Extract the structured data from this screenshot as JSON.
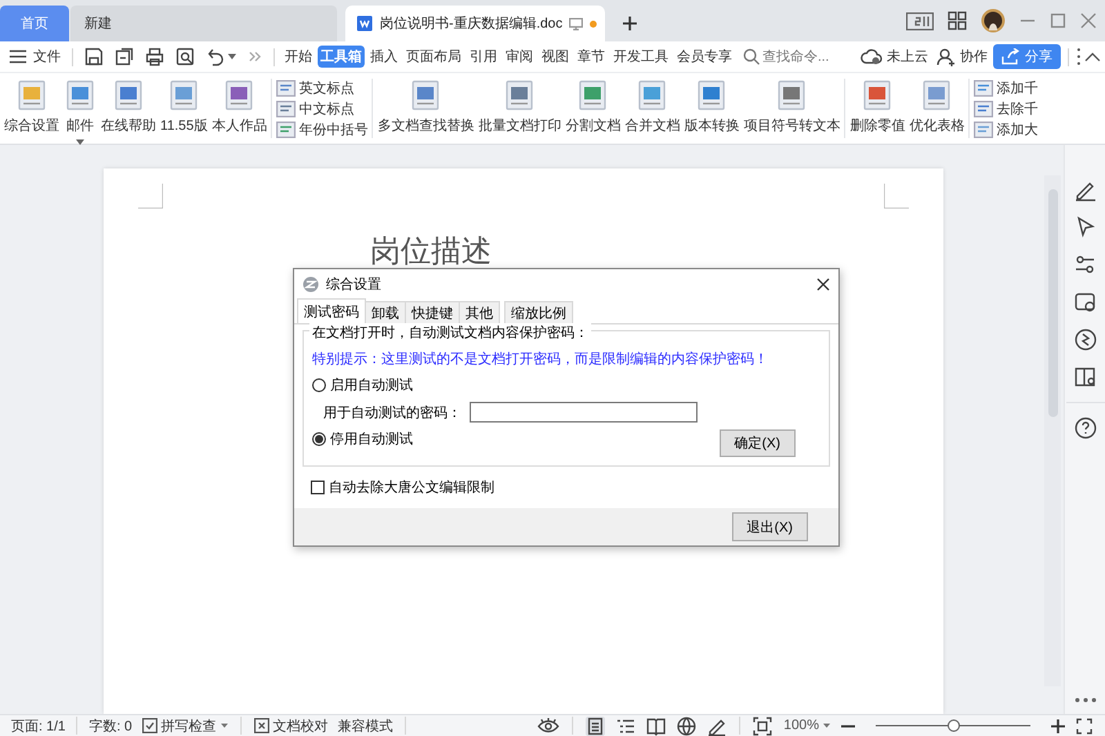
{
  "tabs": [
    {
      "label": "首页",
      "kind": "home",
      "selected": false
    },
    {
      "label": "新建",
      "kind": "new",
      "selected": false
    },
    {
      "label": "岗位说明书-重庆数据编辑.doc",
      "kind": "doc",
      "selected": true,
      "modified": true
    }
  ],
  "menu": {
    "file": "文件",
    "tabs": [
      {
        "label": "开始",
        "selected": false
      },
      {
        "label": "工具箱",
        "selected": true
      },
      {
        "label": "插入",
        "selected": false
      },
      {
        "label": "页面布局",
        "selected": false
      },
      {
        "label": "引用",
        "selected": false
      },
      {
        "label": "审阅",
        "selected": false
      },
      {
        "label": "视图",
        "selected": false
      },
      {
        "label": "章节",
        "selected": false
      },
      {
        "label": "开发工具",
        "selected": false
      },
      {
        "label": "会员专享",
        "selected": false
      }
    ],
    "search": {
      "placeholder": "查找命令..."
    },
    "cloud": "未上云",
    "collab": "协作",
    "share": "分享"
  },
  "ribbon": [
    {
      "kind": "large",
      "label": "综合设置"
    },
    {
      "kind": "large",
      "label": "邮件",
      "dropdown": true
    },
    {
      "kind": "large",
      "label": "在线帮助"
    },
    {
      "kind": "large",
      "label": "11.55版"
    },
    {
      "kind": "large",
      "label": "本人作品"
    },
    {
      "kind": "small",
      "items": [
        "英文标点",
        "中文标点",
        "年份中括号"
      ]
    },
    {
      "kind": "large",
      "label": "多文档查找替换"
    },
    {
      "kind": "large",
      "label": "批量文档打印"
    },
    {
      "kind": "large",
      "label": "分割文档"
    },
    {
      "kind": "large",
      "label": "合并文档"
    },
    {
      "kind": "large",
      "label": "版本转换"
    },
    {
      "kind": "large",
      "label": "项目符号转文本"
    },
    {
      "kind": "large",
      "label": "删除零值"
    },
    {
      "kind": "large",
      "label": "优化表格"
    },
    {
      "kind": "small",
      "items": [
        "添加千",
        "去除千",
        "添加大"
      ]
    }
  ],
  "document": {
    "heading": "岗位描述"
  },
  "dialog": {
    "title": "综合设置",
    "tabs": [
      {
        "label": "测试密码",
        "selected": true
      },
      {
        "label": "卸载",
        "selected": false
      },
      {
        "label": "快捷键",
        "selected": false
      },
      {
        "label": "其他",
        "selected": false
      },
      {
        "label": "缩放比例",
        "selected": false
      }
    ],
    "group_title": "在文档打开时，自动测试文档内容保护密码：",
    "note": "特别提示：这里测试的不是文档打开密码，而是限制编辑的内容保护密码！",
    "radios": [
      {
        "label": "启用自动测试",
        "selected": false
      },
      {
        "label": "停用自动测试",
        "selected": true
      }
    ],
    "password_label": "用于自动测试的密码：",
    "confirm": "确定(X)",
    "checkbox": {
      "label": "自动去除大唐公文编辑限制",
      "checked": false
    },
    "exit": "退出(X)"
  },
  "status_bar": {
    "page": "页面: 1/1",
    "words": "字数: 0",
    "spell": "拼写检查",
    "proof": "文档校对",
    "mode": "兼容模式",
    "zoom": "100%",
    "zoom_slider": {
      "level": 0.5
    }
  }
}
